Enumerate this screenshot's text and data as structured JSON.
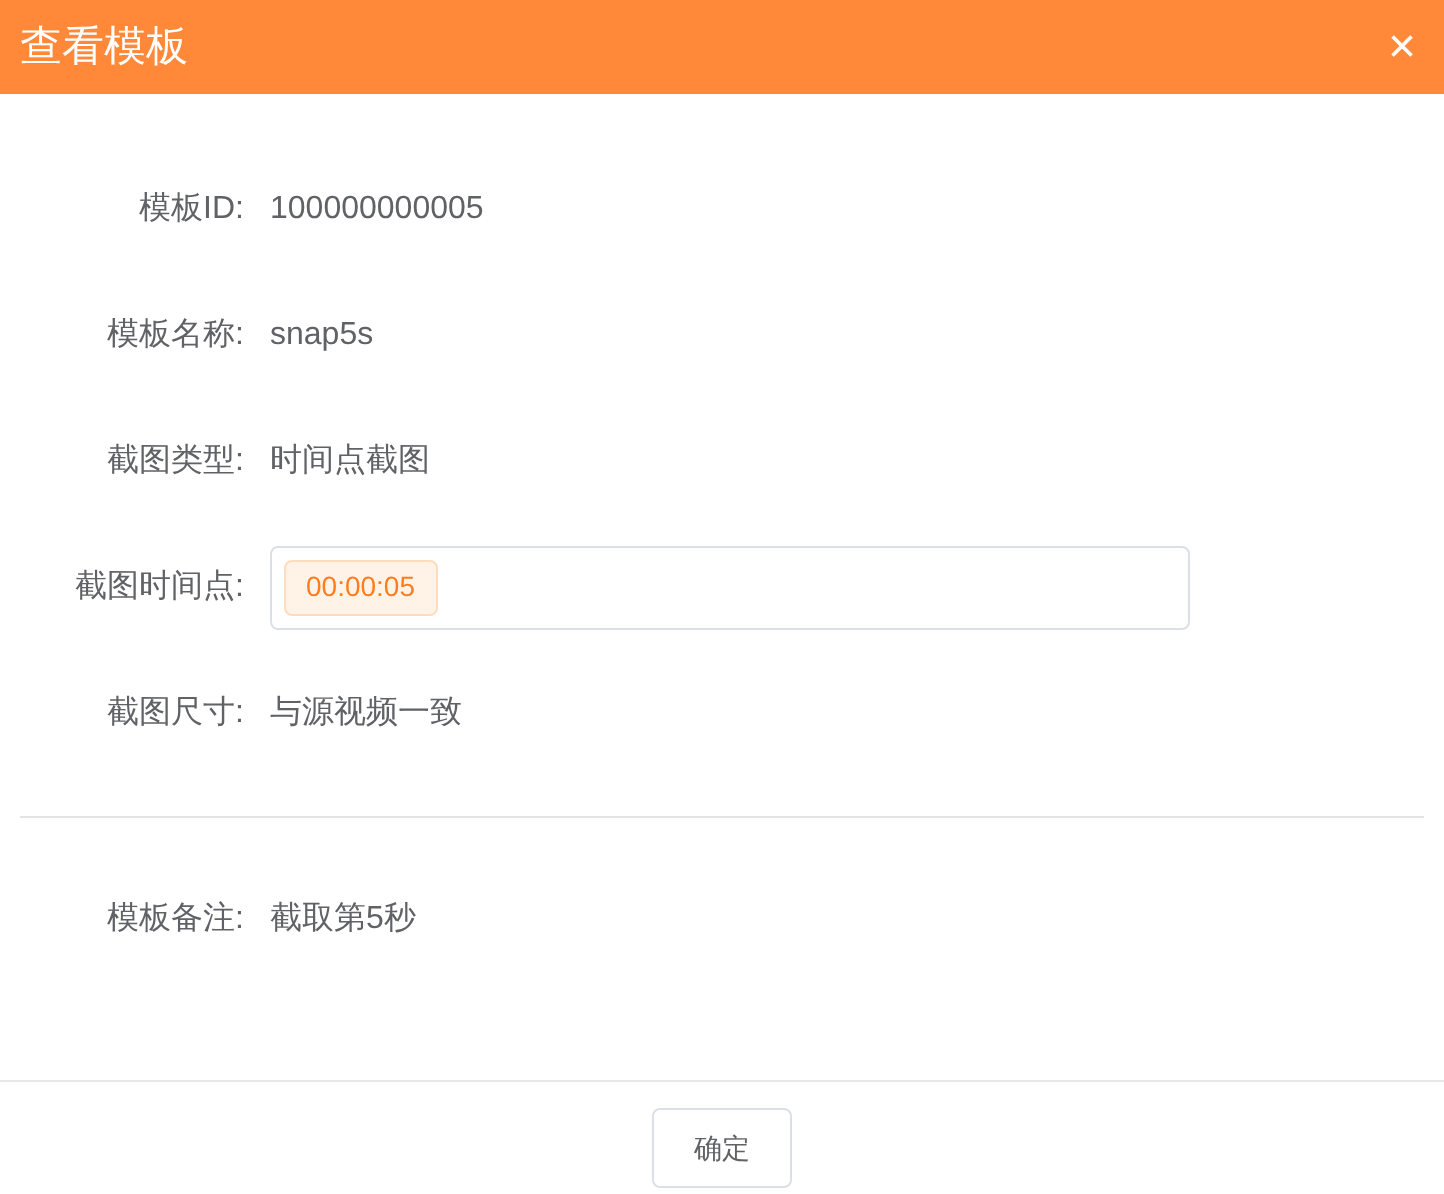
{
  "dialog": {
    "title": "查看模板",
    "close": "×"
  },
  "fields": [
    {
      "kind": "text",
      "label": "模板ID:",
      "value": "100000000005"
    },
    {
      "kind": "text",
      "label": "模板名称:",
      "value": "snap5s"
    },
    {
      "kind": "text",
      "label": "截图类型:",
      "value": "时间点截图"
    },
    {
      "kind": "tags",
      "label": "截图时间点:",
      "tags": [
        "00:00:05"
      ]
    },
    {
      "kind": "text",
      "label": "截图尺寸:",
      "value": "与源视频一致"
    }
  ],
  "remark": {
    "label": "模板备注:",
    "value": "截取第5秒"
  },
  "footer": {
    "confirm": "确定"
  }
}
